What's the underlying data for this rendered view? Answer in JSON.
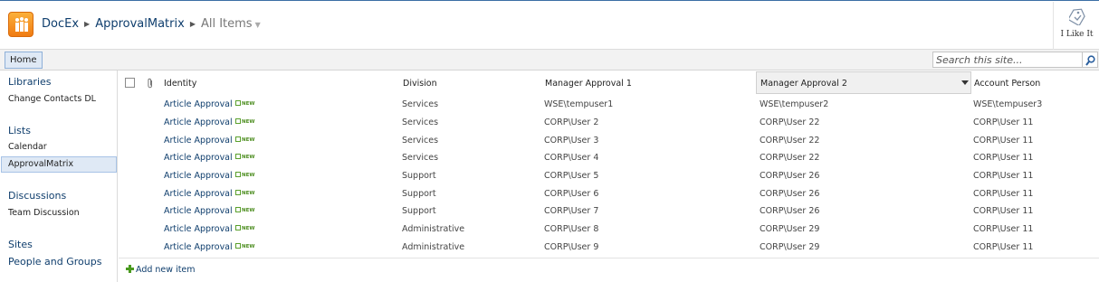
{
  "breadcrumb": {
    "site": "DocEx",
    "list": "ApprovalMatrix",
    "view": "All Items"
  },
  "like": {
    "label": "I Like It"
  },
  "topnav": {
    "home": "Home"
  },
  "search": {
    "placeholder": "Search this site..."
  },
  "sidebar": {
    "libraries_heading": "Libraries",
    "libraries": [
      "Change Contacts DL"
    ],
    "lists_heading": "Lists",
    "lists": [
      "Calendar",
      "ApprovalMatrix"
    ],
    "discussions_heading": "Discussions",
    "discussions": [
      "Team Discussion"
    ],
    "sites_heading": "Sites",
    "people_heading": "People and Groups"
  },
  "list": {
    "columns": {
      "identity": "Identity",
      "division": "Division",
      "manager1": "Manager Approval 1",
      "manager2": "Manager Approval 2",
      "account": "Account Person"
    },
    "new_badge": "NEW",
    "rows": [
      {
        "title": "Article Approval",
        "division": "Services",
        "m1": "WSE\\tempuser1",
        "m2": "WSE\\tempuser2",
        "account": "WSE\\tempuser3"
      },
      {
        "title": "Article Approval",
        "division": "Services",
        "m1": "CORP\\User 2",
        "m2": "CORP\\User 22",
        "account": "CORP\\User 11"
      },
      {
        "title": "Article Approval",
        "division": "Services",
        "m1": "CORP\\User 3",
        "m2": "CORP\\User 22",
        "account": "CORP\\User 11"
      },
      {
        "title": "Article Approval",
        "division": "Services",
        "m1": "CORP\\User 4",
        "m2": "CORP\\User 22",
        "account": "CORP\\User 11"
      },
      {
        "title": "Article Approval",
        "division": "Support",
        "m1": "CORP\\User 5",
        "m2": "CORP\\User 26",
        "account": "CORP\\User 11"
      },
      {
        "title": "Article Approval",
        "division": "Support",
        "m1": "CORP\\User 6",
        "m2": "CORP\\User 26",
        "account": "CORP\\User 11"
      },
      {
        "title": "Article Approval",
        "division": "Support",
        "m1": "CORP\\User 7",
        "m2": "CORP\\User 26",
        "account": "CORP\\User 11"
      },
      {
        "title": "Article Approval",
        "division": "Administrative",
        "m1": "CORP\\User 8",
        "m2": "CORP\\User 29",
        "account": "CORP\\User 11"
      },
      {
        "title": "Article Approval",
        "division": "Administrative",
        "m1": "CORP\\User 9",
        "m2": "CORP\\User 29",
        "account": "CORP\\User 11"
      }
    ],
    "add_item": "Add new item"
  }
}
